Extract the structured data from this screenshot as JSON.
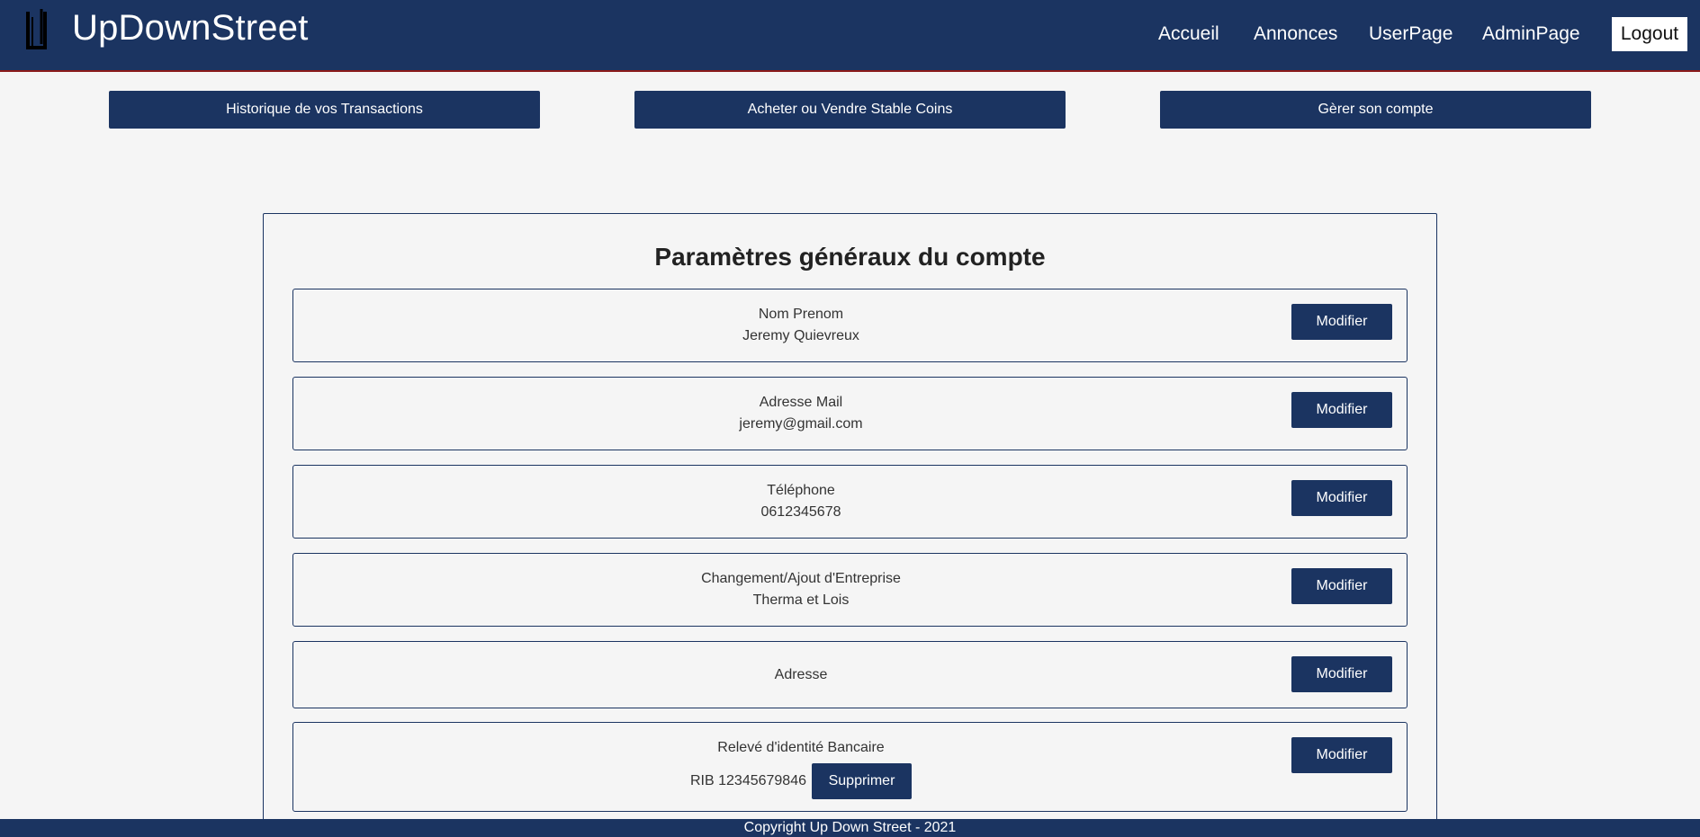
{
  "navbar": {
    "brand": "UpDownStreet",
    "links": [
      "Accueil",
      "Annonces",
      "UserPage",
      "AdminPage"
    ],
    "logout_label": "Logout",
    "colors": {
      "primary": "#1b3461",
      "accent_line": "#8b1a1a"
    }
  },
  "actions": [
    "Historique de vos Transactions",
    "Acheter ou Vendre Stable Coins",
    "Gèrer son compte"
  ],
  "settings": {
    "title": "Paramètres généraux du compte",
    "modify_label": "Modifier",
    "rows": [
      {
        "label": "Nom Prenom",
        "value": "Jeremy Quievreux"
      },
      {
        "label": "Adresse Mail",
        "value": "jeremy@gmail.com"
      },
      {
        "label": "Téléphone",
        "value": "0612345678"
      },
      {
        "label": "Changement/Ajout d'Entreprise",
        "value": "Therma et Lois"
      },
      {
        "label": "Adresse",
        "value": ""
      },
      {
        "label": "Relevé d'identité Bancaire",
        "value": "RIB 12345679846",
        "delete_label": "Supprimer"
      }
    ]
  },
  "footer": {
    "text": "Copyright Up Down Street - 2021"
  }
}
